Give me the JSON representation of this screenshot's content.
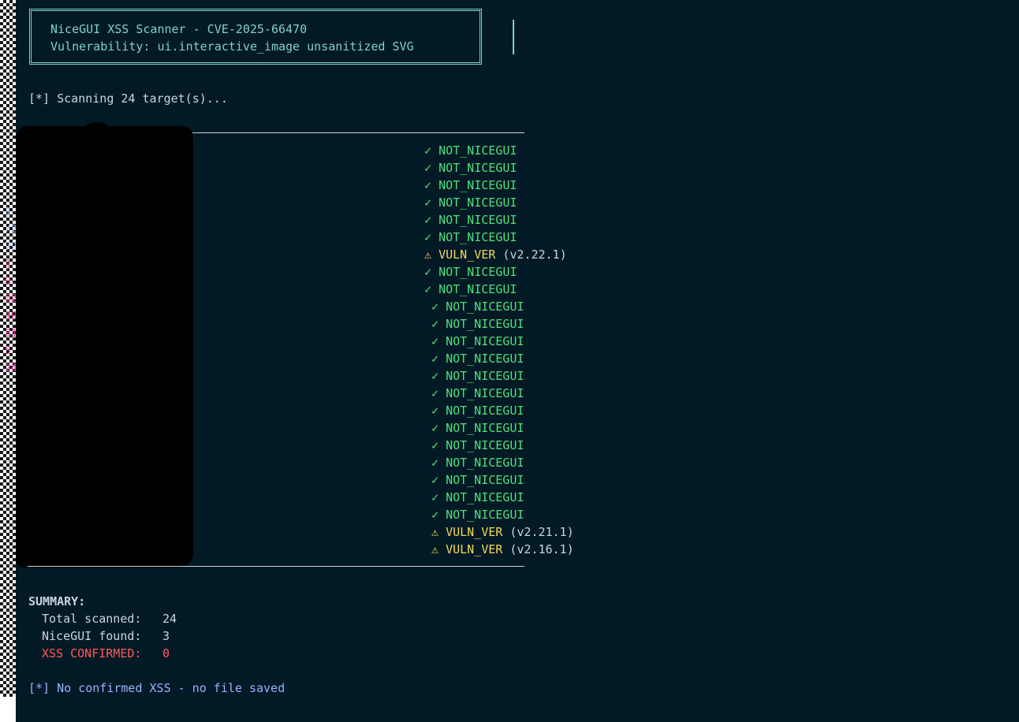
{
  "banner": {
    "title": "NiceGUI XSS Scanner - CVE-2025-66470",
    "subtitle": "Vulnerability: ui.interactive_image unsanitized SVG"
  },
  "scan_start": "[*] Scanning 24 target(s)...",
  "leaked_fragments": [
    "1",
    "/2",
    "72",
    "] 2",
    "0.",
    "02.",
    "194",
    "81",
    "5",
    "249"
  ],
  "results": [
    {
      "icon": "✓",
      "status": "NOT_NICEGUI",
      "version": "",
      "kind": "ok"
    },
    {
      "icon": "✓",
      "status": "NOT_NICEGUI",
      "version": "",
      "kind": "ok"
    },
    {
      "icon": "✓",
      "status": "NOT_NICEGUI",
      "version": "",
      "kind": "ok"
    },
    {
      "icon": "✓",
      "status": "NOT_NICEGUI",
      "version": "",
      "kind": "ok"
    },
    {
      "icon": "✓",
      "status": "NOT_NICEGUI",
      "version": "",
      "kind": "ok"
    },
    {
      "icon": "✓",
      "status": "NOT_NICEGUI",
      "version": "",
      "kind": "ok"
    },
    {
      "icon": "⚠",
      "status": "VULN_VER",
      "version": "(v2.22.1)",
      "kind": "warn"
    },
    {
      "icon": "✓",
      "status": "NOT_NICEGUI",
      "version": "",
      "kind": "ok"
    },
    {
      "icon": "✓",
      "status": "NOT_NICEGUI",
      "version": "",
      "kind": "ok"
    },
    {
      "icon": "✓",
      "status": "NOT_NICEGUI",
      "version": "",
      "kind": "ok"
    },
    {
      "icon": "✓",
      "status": "NOT_NICEGUI",
      "version": "",
      "kind": "ok"
    },
    {
      "icon": "✓",
      "status": "NOT_NICEGUI",
      "version": "",
      "kind": "ok"
    },
    {
      "icon": "✓",
      "status": "NOT_NICEGUI",
      "version": "",
      "kind": "ok"
    },
    {
      "icon": "✓",
      "status": "NOT_NICEGUI",
      "version": "",
      "kind": "ok"
    },
    {
      "icon": "✓",
      "status": "NOT_NICEGUI",
      "version": "",
      "kind": "ok"
    },
    {
      "icon": "✓",
      "status": "NOT_NICEGUI",
      "version": "",
      "kind": "ok"
    },
    {
      "icon": "✓",
      "status": "NOT_NICEGUI",
      "version": "",
      "kind": "ok"
    },
    {
      "icon": "✓",
      "status": "NOT_NICEGUI",
      "version": "",
      "kind": "ok"
    },
    {
      "icon": "✓",
      "status": "NOT_NICEGUI",
      "version": "",
      "kind": "ok"
    },
    {
      "icon": "✓",
      "status": "NOT_NICEGUI",
      "version": "",
      "kind": "ok"
    },
    {
      "icon": "✓",
      "status": "NOT_NICEGUI",
      "version": "",
      "kind": "ok"
    },
    {
      "icon": "✓",
      "status": "NOT_NICEGUI",
      "version": "",
      "kind": "ok"
    },
    {
      "icon": "⚠",
      "status": "VULN_VER",
      "version": "(v2.21.1)",
      "kind": "warn"
    },
    {
      "icon": "⚠",
      "status": "VULN_VER",
      "version": "(v2.16.1)",
      "kind": "warn"
    }
  ],
  "summary": {
    "title": "SUMMARY:",
    "total_label": "Total scanned:",
    "total_value": "24",
    "found_label": "NiceGUI found:",
    "found_value": "3",
    "xss_label": "XSS CONFIRMED:",
    "xss_value": "0"
  },
  "footer": "[*] No confirmed XSS - no file saved",
  "colors": {
    "background": "#011a26",
    "banner": "#7fd1c7",
    "ok": "#4ee07a",
    "warn": "#f2d95a",
    "error": "#ff5a5a",
    "info": "#8fb4ff"
  }
}
